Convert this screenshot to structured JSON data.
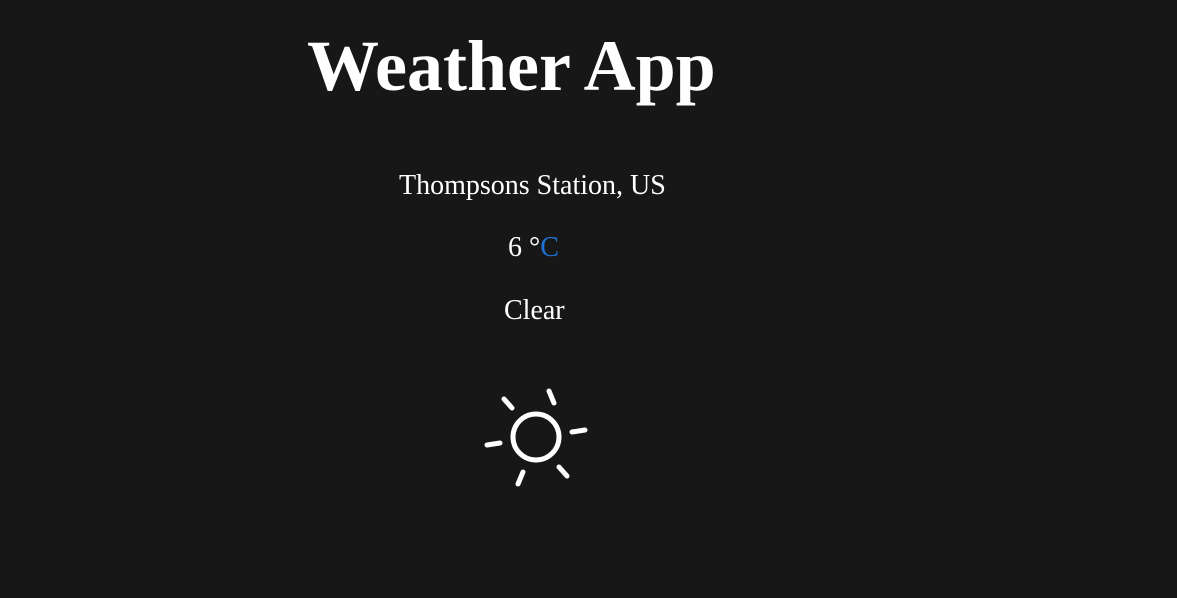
{
  "app": {
    "title": "Weather App"
  },
  "weather": {
    "location": "Thompsons Station, US",
    "temperature_value": "6",
    "degree_symbol": " °",
    "unit": "C",
    "condition": "Clear",
    "icon": "sun-icon"
  },
  "colors": {
    "background": "#171717",
    "text": "#ffffff",
    "unit_link": "#1e73d6"
  }
}
